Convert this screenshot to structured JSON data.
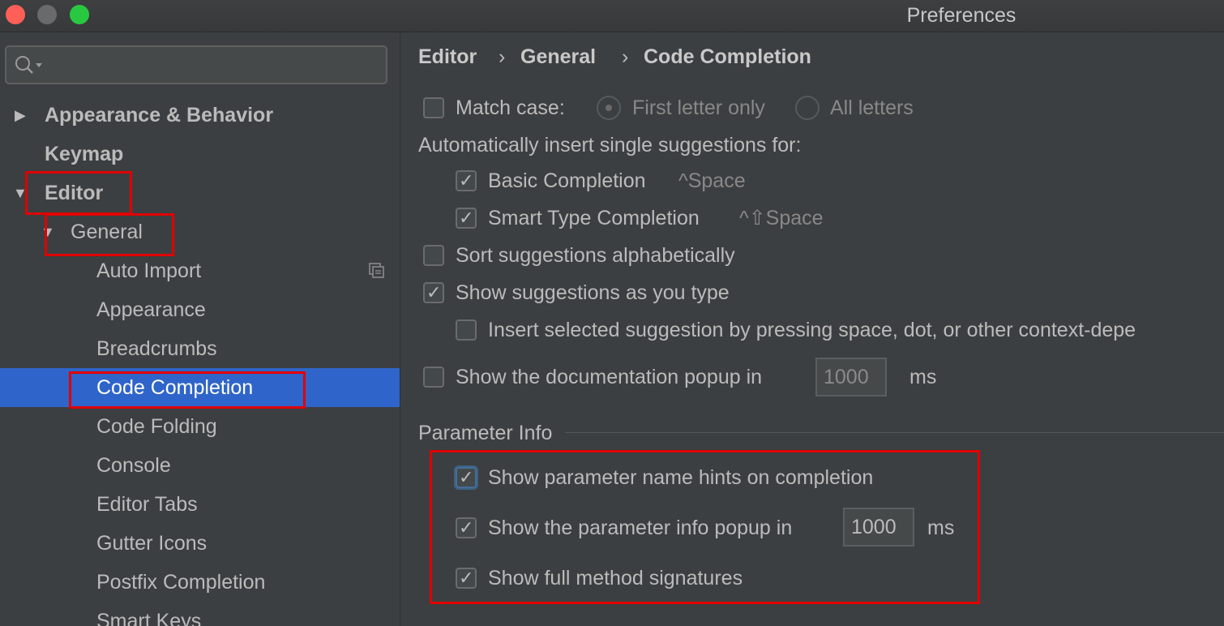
{
  "window": {
    "title": "Preferences"
  },
  "sidebar": {
    "search": {
      "placeholder": "",
      "value": ""
    },
    "items": [
      {
        "label": "Appearance & Behavior"
      },
      {
        "label": "Keymap"
      },
      {
        "label": "Editor"
      },
      {
        "label": "General"
      },
      {
        "label": "Auto Import"
      },
      {
        "label": "Appearance"
      },
      {
        "label": "Breadcrumbs"
      },
      {
        "label": "Code Completion"
      },
      {
        "label": "Code Folding"
      },
      {
        "label": "Console"
      },
      {
        "label": "Editor Tabs"
      },
      {
        "label": "Gutter Icons"
      },
      {
        "label": "Postfix Completion"
      },
      {
        "label": "Smart Keys"
      }
    ]
  },
  "breadcrumb": {
    "items": [
      "Editor",
      "General",
      "Code Completion"
    ],
    "separator": "›"
  },
  "settings": {
    "match_case": {
      "label": "Match case:",
      "checked": false
    },
    "first_letter": {
      "label": "First letter only",
      "selected": true
    },
    "all_letters": {
      "label": "All letters",
      "selected": false
    },
    "auto_insert_heading": "Automatically insert single suggestions for:",
    "basic_completion": {
      "label": "Basic Completion",
      "shortcut": "^Space",
      "checked": true
    },
    "smart_type": {
      "label": "Smart Type Completion",
      "shortcut": "^⇧Space",
      "checked": true
    },
    "sort_alpha": {
      "label": "Sort suggestions alphabetically",
      "checked": false
    },
    "show_as_type": {
      "label": "Show suggestions as you type",
      "checked": true
    },
    "insert_selected": {
      "label": "Insert selected suggestion by pressing space, dot, or other context-depe",
      "checked": false
    },
    "doc_popup": {
      "label": "Show the documentation popup in",
      "value": "1000",
      "unit": "ms",
      "checked": false
    }
  },
  "parameter_info": {
    "title": "Parameter Info",
    "name_hints": {
      "label": "Show parameter name hints on completion",
      "checked": true
    },
    "info_popup": {
      "label": "Show the parameter info popup in",
      "value": "1000",
      "unit": "ms",
      "checked": true
    },
    "full_signatures": {
      "label": "Show full method signatures",
      "checked": true
    }
  },
  "colors": {
    "selection": "#2f65ca",
    "highlight_box": "#e00000",
    "background": "#3c3f41"
  }
}
